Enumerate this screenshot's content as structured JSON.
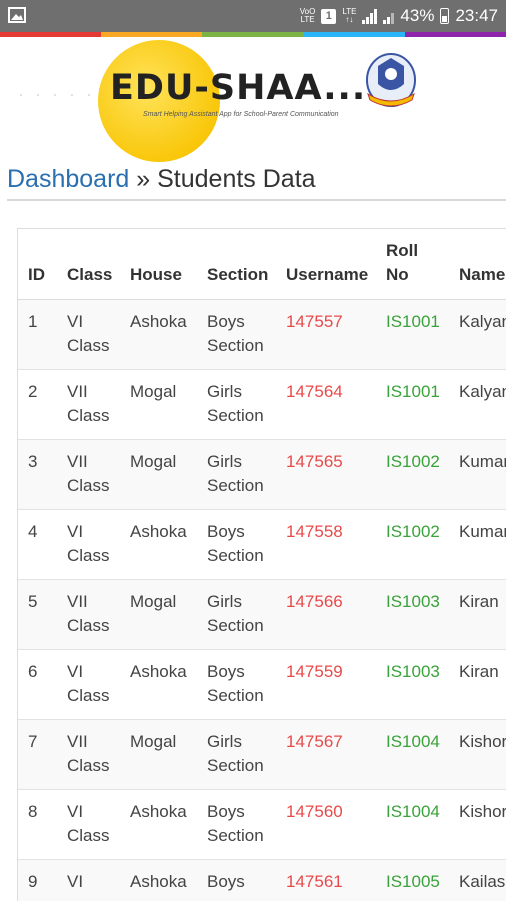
{
  "status_bar": {
    "carrier_tag_top": "VoO",
    "carrier_tag_bottom": "LTE",
    "sim_label": "1",
    "network_tag": "LTE",
    "battery": "43%",
    "time": "23:47"
  },
  "colors": {
    "strip": [
      "#e53935",
      "#f9a825",
      "#7cb342",
      "#29b6f6",
      "#8e24aa"
    ],
    "link": "#2a6fb0",
    "username": "#e84a4a",
    "roll": "#3aa23a"
  },
  "header": {
    "logo_text": "EDU-SHAA...",
    "tagline": "Smart Helping Assistant App for School-Parent Communication"
  },
  "breadcrumb": {
    "link": "Dashboard",
    "separator": "»",
    "current": "Students Data"
  },
  "table": {
    "headers": {
      "id": "ID",
      "class": "Class",
      "house": "House",
      "section": "Section",
      "username": "Username",
      "roll_line1": "Roll",
      "roll_line2": "No",
      "name": "Name"
    },
    "rows": [
      {
        "id": "1",
        "class1": "VI",
        "class2": "Class",
        "house": "Ashoka",
        "section1": "Boys",
        "section2": "Section",
        "username": "147557",
        "roll": "IS1001",
        "name": "Kalyan"
      },
      {
        "id": "2",
        "class1": "VII",
        "class2": "Class",
        "house": "Mogal",
        "section1": "Girls",
        "section2": "Section",
        "username": "147564",
        "roll": "IS1001",
        "name": "Kalyan"
      },
      {
        "id": "3",
        "class1": "VII",
        "class2": "Class",
        "house": "Mogal",
        "section1": "Girls",
        "section2": "Section",
        "username": "147565",
        "roll": "IS1002",
        "name": "Kumar"
      },
      {
        "id": "4",
        "class1": "VI",
        "class2": "Class",
        "house": "Ashoka",
        "section1": "Boys",
        "section2": "Section",
        "username": "147558",
        "roll": "IS1002",
        "name": "Kumar"
      },
      {
        "id": "5",
        "class1": "VII",
        "class2": "Class",
        "house": "Mogal",
        "section1": "Girls",
        "section2": "Section",
        "username": "147566",
        "roll": "IS1003",
        "name": "Kiran"
      },
      {
        "id": "6",
        "class1": "VI",
        "class2": "Class",
        "house": "Ashoka",
        "section1": "Boys",
        "section2": "Section",
        "username": "147559",
        "roll": "IS1003",
        "name": "Kiran"
      },
      {
        "id": "7",
        "class1": "VII",
        "class2": "Class",
        "house": "Mogal",
        "section1": "Girls",
        "section2": "Section",
        "username": "147567",
        "roll": "IS1004",
        "name": "Kishor"
      },
      {
        "id": "8",
        "class1": "VI",
        "class2": "Class",
        "house": "Ashoka",
        "section1": "Boys",
        "section2": "Section",
        "username": "147560",
        "roll": "IS1004",
        "name": "Kishor"
      },
      {
        "id": "9",
        "class1": "VI",
        "class2": "",
        "house": "Ashoka",
        "section1": "Boys",
        "section2": "",
        "username": "147561",
        "roll": "IS1005",
        "name": "Kailas"
      }
    ]
  }
}
